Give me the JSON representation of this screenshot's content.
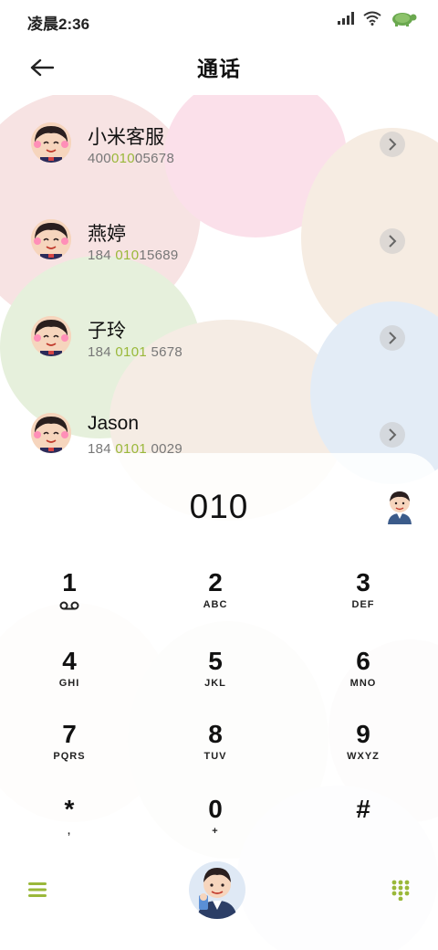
{
  "status": {
    "time": "凌晨2:36"
  },
  "header": {
    "title": "通话"
  },
  "contacts": [
    {
      "name": "小米客服",
      "num_pre": "400",
      "num_hl": "010",
      "num_post": "05678"
    },
    {
      "name": "燕婷",
      "num_pre": "184 ",
      "num_hl": "010",
      "num_post": "15689"
    },
    {
      "name": "子玲",
      "num_pre": "184 ",
      "num_hl": "0101",
      "num_post": " 5678"
    },
    {
      "name": "Jason",
      "num_pre": "184 ",
      "num_hl": "0101",
      "num_post": " 0029"
    }
  ],
  "dialer": {
    "number": "010",
    "keys": [
      {
        "digit": "1",
        "letters": ""
      },
      {
        "digit": "2",
        "letters": "ABC"
      },
      {
        "digit": "3",
        "letters": "DEF"
      },
      {
        "digit": "4",
        "letters": "GHI"
      },
      {
        "digit": "5",
        "letters": "JKL"
      },
      {
        "digit": "6",
        "letters": "MNO"
      },
      {
        "digit": "7",
        "letters": "PQRS"
      },
      {
        "digit": "8",
        "letters": "TUV"
      },
      {
        "digit": "9",
        "letters": "WXYZ"
      },
      {
        "digit": "*",
        "letters": ","
      },
      {
        "digit": "0",
        "letters": "+"
      },
      {
        "digit": "#",
        "letters": ""
      }
    ]
  },
  "colors": {
    "accent": "#9ab83a",
    "chevron_bg": "#c8c8c8"
  },
  "icons": {
    "back": "arrow-left-icon",
    "voicemail": "voicemail-icon",
    "menu": "menu-icon",
    "keypad": "keypad-icon",
    "call": "call-avatar-icon",
    "add_contact": "contact-avatar-icon"
  }
}
